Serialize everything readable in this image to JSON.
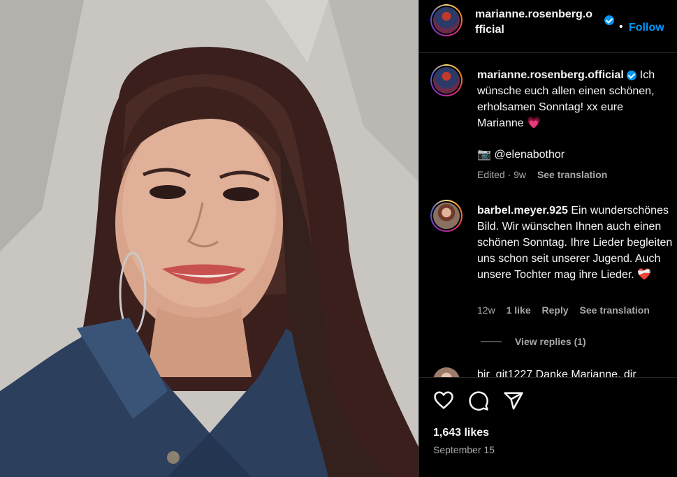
{
  "post": {
    "username": "marianne.rosenberg.official",
    "header_username_line1": "marianne.rosenberg.o",
    "header_username_line2": "fficial",
    "follow_label": "Follow",
    "dot": "•"
  },
  "caption": {
    "username": "marianne.rosenberg.official",
    "text": " Ich wünsche euch allen einen schönen, erholsamen Sonntag! xx eure Marianne 💗",
    "credit": "📷 @elenabothor",
    "edited": "Edited · 9w",
    "see_translation": "See translation"
  },
  "comments": [
    {
      "username": "barbel.meyer.925",
      "text": " Ein wunderschönes Bild. Wir wünschen Ihnen auch einen schönen Sonntag. Ihre Lieder begleiten uns schon seit unserer Jugend. Auch unsere Tochter mag ihre Lieder. ❤️‍🩹",
      "age": "12w",
      "likes": "1 like",
      "reply": "Reply",
      "see_translation": "See translation",
      "view_replies": "View replies (1)"
    },
    {
      "partial_text": "bir_git1227 Danke Marianne, dir"
    }
  ],
  "footer": {
    "likes": "1,643 likes",
    "date": "September 15"
  },
  "icons": [
    "heart-icon",
    "comment-icon",
    "share-icon",
    "verified-icon"
  ],
  "colors": {
    "accent": "#0095f6",
    "background": "#000000",
    "muted": "#a8a8a8"
  }
}
